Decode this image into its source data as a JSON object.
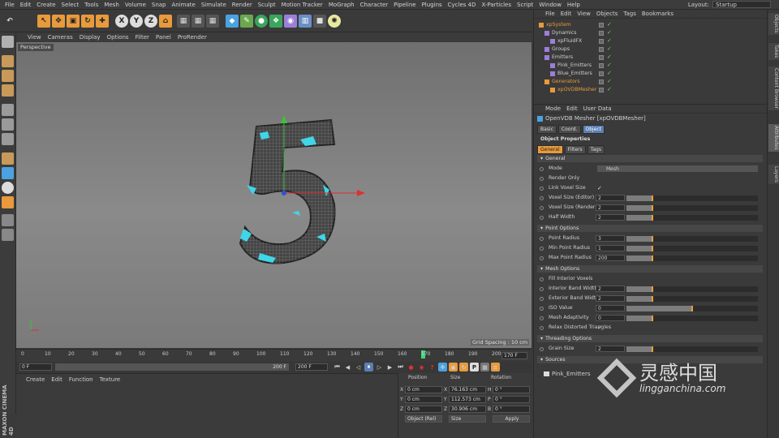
{
  "menubar": [
    "File",
    "Edit",
    "Create",
    "Select",
    "Tools",
    "Mesh",
    "Volume",
    "Snap",
    "Animate",
    "Simulate",
    "Render",
    "Sculpt",
    "Motion Tracker",
    "MoGraph",
    "Character",
    "Pipeline",
    "Plugins",
    "Cycles 4D",
    "X-Particles",
    "Script",
    "Window",
    "Help"
  ],
  "layout": {
    "label": "Layout:",
    "value": "Startup"
  },
  "viewport_menu": [
    "View",
    "Cameras",
    "Display",
    "Options",
    "Filter",
    "Panel",
    "ProRender"
  ],
  "viewport_label": "Perspective",
  "grid_spacing": "Grid Spacing : 10 cm",
  "timeline": {
    "ticks": [
      "0",
      "10",
      "20",
      "30",
      "40",
      "50",
      "60",
      "70",
      "80",
      "90",
      "100",
      "110",
      "120",
      "130",
      "140",
      "150",
      "160",
      "170",
      "180",
      "190",
      "200"
    ],
    "current": "170 F",
    "current_frame": 170
  },
  "playbar": {
    "start": "0 F",
    "start2": "0 F",
    "end": "200 F",
    "end2": "200 F"
  },
  "bottom_menu": [
    "Create",
    "Edit",
    "Function",
    "Texture"
  ],
  "coords": {
    "headers": [
      "Position",
      "Size",
      "Rotation"
    ],
    "rows": [
      {
        "a": "X",
        "p": "0 cm",
        "b": "X",
        "s": "76.163 cm",
        "c": "H",
        "r": "0 °"
      },
      {
        "a": "Y",
        "p": "0 cm",
        "b": "Y",
        "s": "112.573 cm",
        "c": "P",
        "r": "0 °"
      },
      {
        "a": "Z",
        "p": "0 cm",
        "b": "Z",
        "s": "30.906 cm",
        "c": "B",
        "r": "0 °"
      }
    ],
    "mode": "Object (Rel)",
    "size_mode": "Size",
    "apply": "Apply"
  },
  "objects": {
    "menu": [
      "File",
      "Edit",
      "View",
      "Objects",
      "Tags",
      "Bookmarks"
    ],
    "items": [
      {
        "name": "xpSystem",
        "color": "#e89a3c",
        "indent": 0
      },
      {
        "name": "Dynamics",
        "color": "#cfcfcf",
        "indent": 1
      },
      {
        "name": "xpFluidFX",
        "color": "#cfcfcf",
        "indent": 2
      },
      {
        "name": "Groups",
        "color": "#cfcfcf",
        "indent": 1
      },
      {
        "name": "Emitters",
        "color": "#cfcfcf",
        "indent": 1
      },
      {
        "name": "Pink_Emitters",
        "color": "#cfcfcf",
        "indent": 2
      },
      {
        "name": "Blue_Emitters",
        "color": "#cfcfcf",
        "indent": 2
      },
      {
        "name": "Generators",
        "color": "#e89a3c",
        "indent": 1
      },
      {
        "name": "xpOVDBMesher",
        "color": "#e89a3c",
        "indent": 2
      }
    ]
  },
  "attributes": {
    "menu": [
      "Mode",
      "Edit",
      "User Data"
    ],
    "title": "OpenVDB Mesher [xpOVDBMesher]",
    "tabs": [
      "Basic",
      "Coord.",
      "Object"
    ],
    "section": "Object Properties",
    "subtabs": [
      "General",
      "Filters",
      "Tags"
    ],
    "groups": [
      {
        "name": "General",
        "props": [
          {
            "label": "Mode",
            "value": "Mesh",
            "type": "select"
          },
          {
            "label": "Render Only",
            "value": "",
            "type": "check"
          },
          {
            "label": "Link Voxel Size",
            "value": "✓",
            "type": "check"
          },
          {
            "label": "Voxel Size (Editor)",
            "value": "2",
            "type": "slider",
            "fill": 0.06,
            "mark": 0.06
          },
          {
            "label": "Voxel Size (Render)",
            "value": "2",
            "type": "slider",
            "fill": 0.06,
            "mark": 0.06
          },
          {
            "label": "Half Width",
            "value": "2",
            "type": "slider",
            "fill": 0.06,
            "mark": 0.06
          }
        ]
      },
      {
        "name": "Point Options",
        "props": [
          {
            "label": "Point Radius",
            "value": "3",
            "type": "slider",
            "fill": 0.02,
            "mark": 0.02
          },
          {
            "label": "Min Point Radius",
            "value": "1",
            "type": "slider",
            "fill": 0.01,
            "mark": 0.01
          },
          {
            "label": "Max Point Radius",
            "value": "200",
            "type": "slider",
            "fill": 0.2,
            "mark": 0.2
          }
        ]
      },
      {
        "name": "Mesh Options",
        "props": [
          {
            "label": "Fill Interior Voxels",
            "value": "",
            "type": "check"
          },
          {
            "label": "Interior Band Width",
            "value": "2",
            "type": "slider",
            "fill": 0.2,
            "mark": 0.2
          },
          {
            "label": "Exterior Band Width",
            "value": "2",
            "type": "slider",
            "fill": 0.2,
            "mark": 0.2
          },
          {
            "label": "ISO Value",
            "value": "0",
            "type": "slider",
            "fill": 0.5,
            "mark": 0.5
          },
          {
            "label": "Mesh Adaptivity",
            "value": "0",
            "type": "slider",
            "fill": 0.01,
            "mark": 0.01
          },
          {
            "label": "Relax Distorted Triangles",
            "value": "✓",
            "type": "check"
          }
        ]
      },
      {
        "name": "Threading Options",
        "props": [
          {
            "label": "Grain Size",
            "value": "2",
            "type": "slider",
            "fill": 0.2,
            "mark": 0.2
          }
        ]
      },
      {
        "name": "Sources",
        "props": []
      }
    ],
    "source_item": "Pink_Emitters"
  },
  "right_tabs": [
    "Objects",
    "Takes",
    "Content Browser",
    "Attributes",
    "Layers"
  ],
  "watermark": {
    "cn": "灵感中国",
    "url": "lingganchina.com"
  },
  "colors": {
    "accent": "#e89a3c",
    "select": "#5b7fb5",
    "cyan": "#3fd6e8"
  }
}
